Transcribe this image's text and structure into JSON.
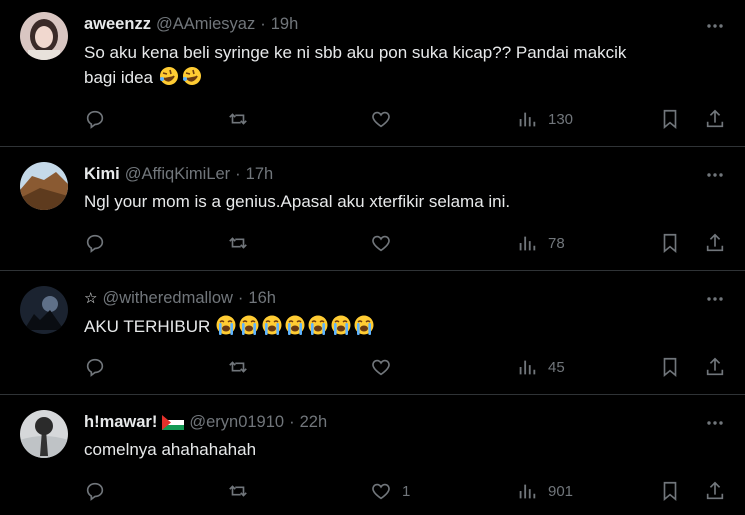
{
  "tweets": [
    {
      "name": "aweenzz",
      "handle": "@AAmiesyaz",
      "dot": "·",
      "time": "19h",
      "text_line1": "So aku kena beli syringe ke ni sbb aku pon suka kicap?? Pandai makcik",
      "text_line2": "bagi idea",
      "emojis": [
        "rofl",
        "rofl"
      ],
      "likes": "",
      "views": "130"
    },
    {
      "name": "Kimi",
      "handle": "@AffiqKimiLer",
      "dot": "·",
      "time": "17h",
      "text_line1": "Ngl your mom is a genius.Apasal aku xterfikir selama ini.",
      "likes": "",
      "views": "78"
    },
    {
      "name": "",
      "star": "☆",
      "handle": "@witheredmallow",
      "dot": "·",
      "time": "16h",
      "text_line1": "AKU TERHIBUR",
      "emojis": [
        "sob",
        "sob",
        "sob",
        "sob",
        "sob",
        "sob",
        "sob"
      ],
      "likes": "",
      "views": "45"
    },
    {
      "name": "h!mawar!",
      "flag": "palestine-flag",
      "handle": "@eryn01910",
      "dot": "·",
      "time": "22h",
      "text_line1": "comelnya ahahahahah",
      "likes": "1",
      "views": "901"
    }
  ],
  "colors": {
    "background": "#000000",
    "text": "#e7e9ea",
    "muted": "#71767b",
    "divider": "#2f3336"
  },
  "icons": [
    "more-icon",
    "reply-icon",
    "retweet-icon",
    "like-icon",
    "views-icon",
    "bookmark-icon",
    "share-icon"
  ]
}
